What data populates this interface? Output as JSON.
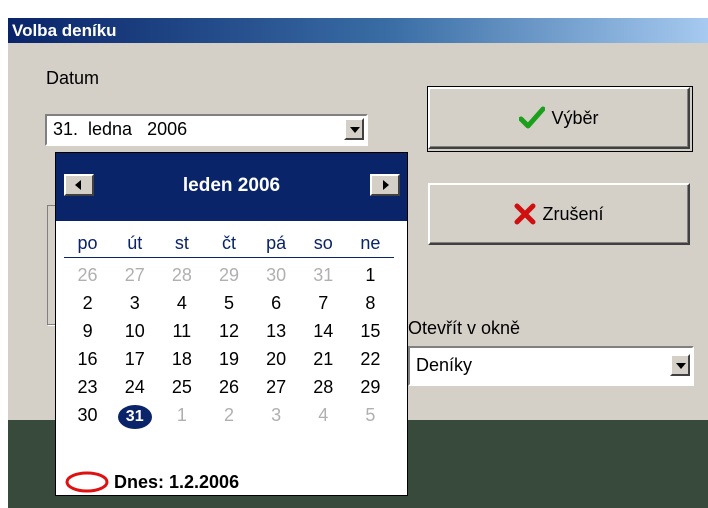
{
  "window": {
    "title": "Volba deníku"
  },
  "date_field": {
    "label": "Datum",
    "value": "31.  ledna   2006"
  },
  "buttons": {
    "select_label": "Výběr",
    "cancel_label": "Zrušení"
  },
  "open_in": {
    "label": "Otevřít v okně",
    "value": "Deníky"
  },
  "calendar": {
    "month_title": "leden 2006",
    "weekdays": [
      "po",
      "út",
      "st",
      "čt",
      "pá",
      "so",
      "ne"
    ],
    "days": [
      [
        "26",
        "27",
        "28",
        "29",
        "30",
        "31",
        "1"
      ],
      [
        "2",
        "3",
        "4",
        "5",
        "6",
        "7",
        "8"
      ],
      [
        "9",
        "10",
        "11",
        "12",
        "13",
        "14",
        "15"
      ],
      [
        "16",
        "17",
        "18",
        "19",
        "20",
        "21",
        "22"
      ],
      [
        "23",
        "24",
        "25",
        "26",
        "27",
        "28",
        "29"
      ],
      [
        "30",
        "31",
        "1",
        "2",
        "3",
        "4",
        "5"
      ]
    ],
    "today_label": "Dnes: 1.2.2006"
  },
  "colors": {
    "calendar_header": "#0a246a",
    "check": "#1aa01a",
    "cancel_x": "#d01010",
    "today_circle": "#e01010"
  }
}
